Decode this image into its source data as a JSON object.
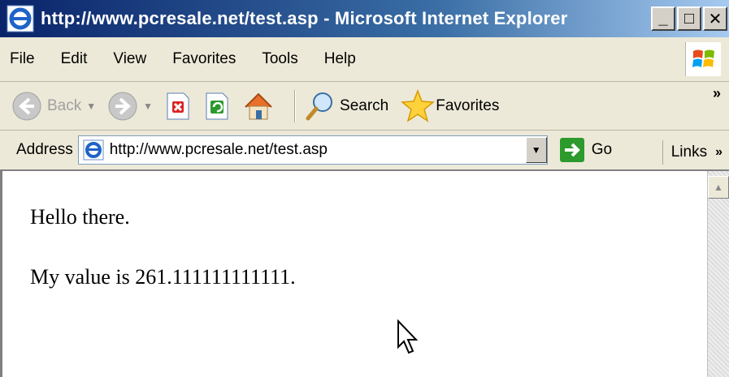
{
  "window": {
    "title": "http://www.pcresale.net/test.asp - Microsoft Internet Explorer",
    "buttons": [
      "_",
      "□",
      "✕"
    ]
  },
  "menu": {
    "items": [
      "File",
      "Edit",
      "View",
      "Favorites",
      "Tools",
      "Help"
    ]
  },
  "toolbar": {
    "back_label": "Back",
    "search_label": "Search",
    "favorites_label": "Favorites",
    "more_label": "»"
  },
  "address": {
    "label": "Address",
    "value": "http://www.pcresale.net/test.asp",
    "go_label": "Go",
    "links_label": "Links",
    "links_more": "»"
  },
  "page": {
    "line1": "Hello there.",
    "line2": "My value is 261.111111111111."
  },
  "colors": {
    "title_start": "#0a246a",
    "title_end": "#a6caf0",
    "chrome": "#ece9d8"
  }
}
